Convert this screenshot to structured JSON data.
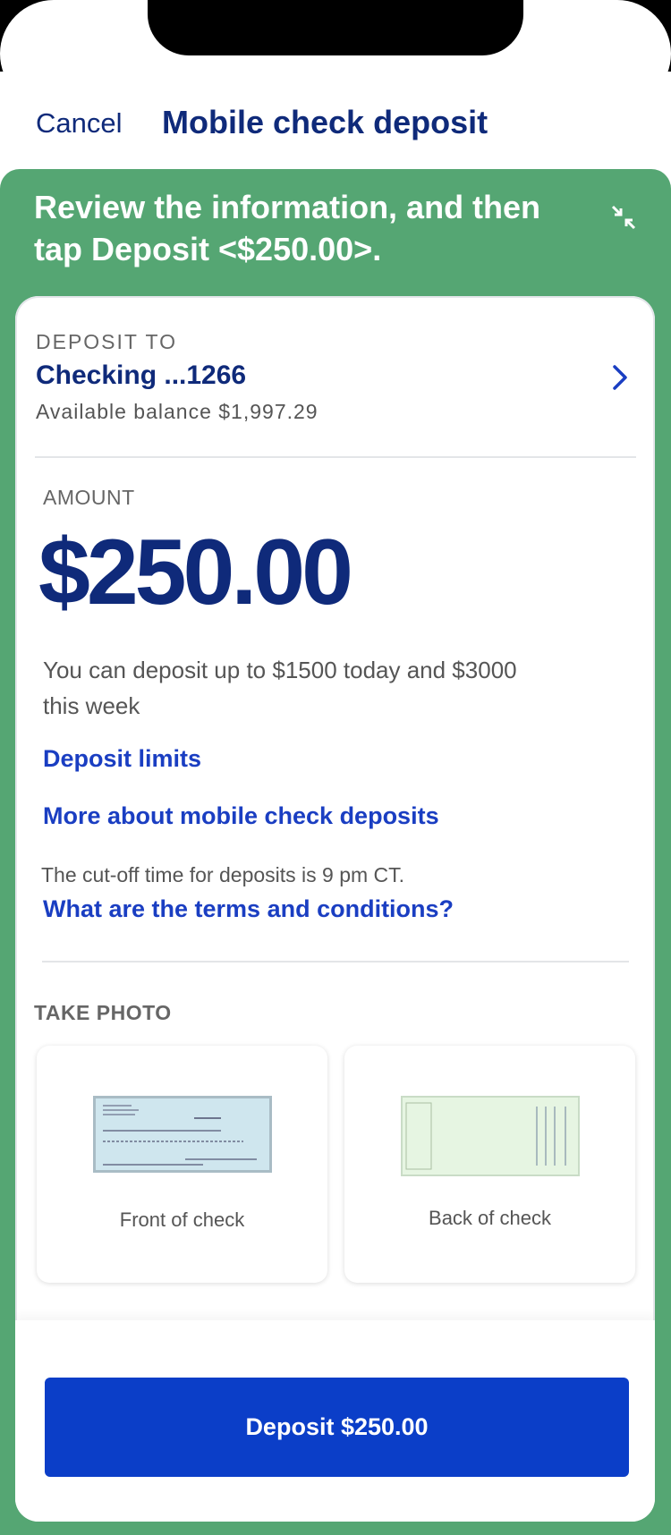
{
  "header": {
    "cancel_label": "Cancel",
    "title": "Mobile check deposit"
  },
  "banner": {
    "instruction": "Review the information, and then tap Deposit <$250.00>.",
    "collapse_icon": "collapse-arrows-icon"
  },
  "deposit_to": {
    "label": "DEPOSIT TO",
    "account": "Checking ...1266",
    "balance": "Available balance $1,997.29"
  },
  "amount": {
    "label": "AMOUNT",
    "value": "$250.00",
    "limits_text": "You can deposit up to $1500 today and $3000 this week",
    "deposit_limits_link": "Deposit limits",
    "more_about_link": "More about mobile check deposits",
    "cutoff_text": "The cut-off time for deposits is 9 pm CT.",
    "terms_link": "What are the terms and conditions?"
  },
  "take_photo": {
    "label": "TAKE PHOTO",
    "front_label": "Front of check",
    "back_label": "Back of check"
  },
  "footer": {
    "deposit_button": "Deposit $250.00"
  },
  "colors": {
    "brand_navy": "#0f2a7a",
    "link_blue": "#1a3ec2",
    "button_blue": "#0b3ec8",
    "frame_green": "#55a673"
  }
}
